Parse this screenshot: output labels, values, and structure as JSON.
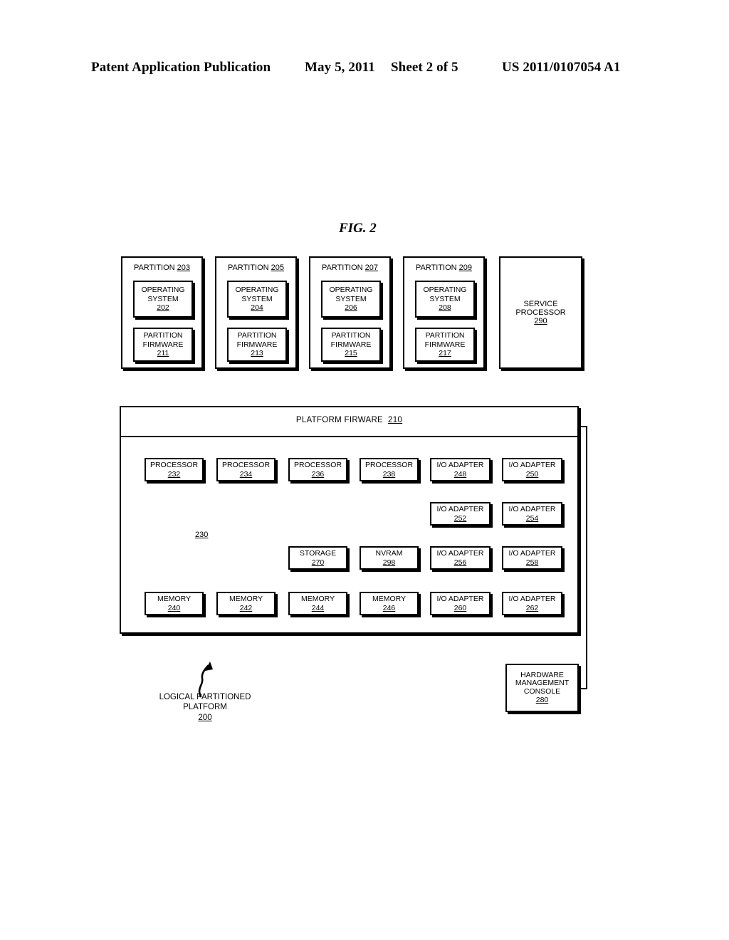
{
  "header": {
    "publication": "Patent Application Publication",
    "date": "May 5, 2011",
    "sheet": "Sheet 2 of 5",
    "number": "US 2011/0107054 A1"
  },
  "figure": {
    "label": "FIG. 2"
  },
  "partitions": [
    {
      "title": "PARTITION",
      "ref": "203",
      "os_line1": "OPERATING",
      "os_line2": "SYSTEM",
      "os_ref": "202",
      "fw_line1": "PARTITION",
      "fw_line2": "FIRMWARE",
      "fw_ref": "211"
    },
    {
      "title": "PARTITION",
      "ref": "205",
      "os_line1": "OPERATING",
      "os_line2": "SYSTEM",
      "os_ref": "204",
      "fw_line1": "PARTITION",
      "fw_line2": "FIRMWARE",
      "fw_ref": "213"
    },
    {
      "title": "PARTITION",
      "ref": "207",
      "os_line1": "OPERATING",
      "os_line2": "SYSTEM",
      "os_ref": "206",
      "fw_line1": "PARTITION",
      "fw_line2": "FIRMWARE",
      "fw_ref": "215"
    },
    {
      "title": "PARTITION",
      "ref": "209",
      "os_line1": "OPERATING",
      "os_line2": "SYSTEM",
      "os_ref": "208",
      "fw_line1": "PARTITION",
      "fw_line2": "FIRMWARE",
      "fw_ref": "217"
    }
  ],
  "service_processor": {
    "line1": "SERVICE",
    "line2": "PROCESSOR",
    "ref": "290"
  },
  "platform_firmware": {
    "title": "PLATFORM FIRWARE",
    "ref": "210"
  },
  "partitioned_hardware": {
    "ref": "230",
    "resources": [
      {
        "label": "PROCESSOR",
        "ref": "232"
      },
      {
        "label": "PROCESSOR",
        "ref": "234"
      },
      {
        "label": "PROCESSOR",
        "ref": "236"
      },
      {
        "label": "PROCESSOR",
        "ref": "238"
      },
      {
        "label": "I/O ADAPTER",
        "ref": "248"
      },
      {
        "label": "I/O ADAPTER",
        "ref": "250"
      },
      {
        "label": "I/O ADAPTER",
        "ref": "252"
      },
      {
        "label": "I/O ADAPTER",
        "ref": "254"
      },
      {
        "label": "STORAGE",
        "ref": "270"
      },
      {
        "label": "NVRAM",
        "ref": "298"
      },
      {
        "label": "I/O ADAPTER",
        "ref": "256"
      },
      {
        "label": "I/O ADAPTER",
        "ref": "258"
      },
      {
        "label": "MEMORY",
        "ref": "240"
      },
      {
        "label": "MEMORY",
        "ref": "242"
      },
      {
        "label": "MEMORY",
        "ref": "244"
      },
      {
        "label": "MEMORY",
        "ref": "246"
      },
      {
        "label": "I/O ADAPTER",
        "ref": "260"
      },
      {
        "label": "I/O ADAPTER",
        "ref": "262"
      }
    ]
  },
  "hardware_management_console": {
    "line1": "HARDWARE",
    "line2": "MANAGEMENT",
    "line3": "CONSOLE",
    "ref": "280"
  },
  "caption": {
    "line1": "LOGICAL PARTITIONED",
    "line2": "PLATFORM",
    "ref": "200"
  }
}
